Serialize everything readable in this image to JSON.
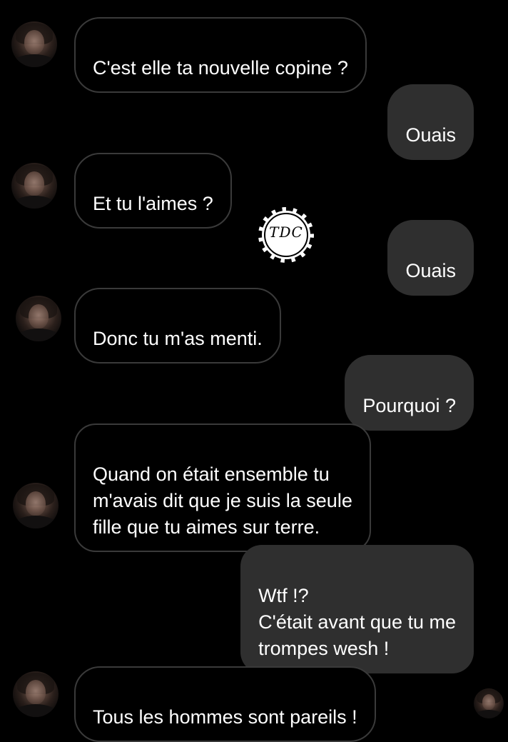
{
  "conversation": {
    "messages": [
      {
        "direction": "in",
        "text": "C'est elle ta nouvelle copine ?"
      },
      {
        "direction": "out",
        "text": "Ouais"
      },
      {
        "direction": "in",
        "text": "Et tu l'aimes ?"
      },
      {
        "direction": "out",
        "text": "Ouais"
      },
      {
        "direction": "in",
        "text": "Donc tu m'as menti."
      },
      {
        "direction": "out",
        "text": "Pourquoi ?"
      },
      {
        "direction": "in",
        "text": "Quand on était ensemble tu\nm'avais dit que je suis la seule\nfille que tu aimes sur terre."
      },
      {
        "direction": "out",
        "text": "Wtf !?\nC'était avant que tu me\ntrompes wesh !"
      },
      {
        "direction": "in",
        "text": "Tous les hommes sont pareils !"
      }
    ]
  },
  "watermark": {
    "text": "TDC"
  },
  "colors": {
    "background": "#000000",
    "incoming_border": "#3a3a3a",
    "outgoing_fill": "#2f2f2f",
    "text": "#ffffff"
  },
  "icons": {
    "contact_avatar": "contact-avatar",
    "seen_avatar": "seen-avatar",
    "watermark_logo": "watermark-logo"
  }
}
